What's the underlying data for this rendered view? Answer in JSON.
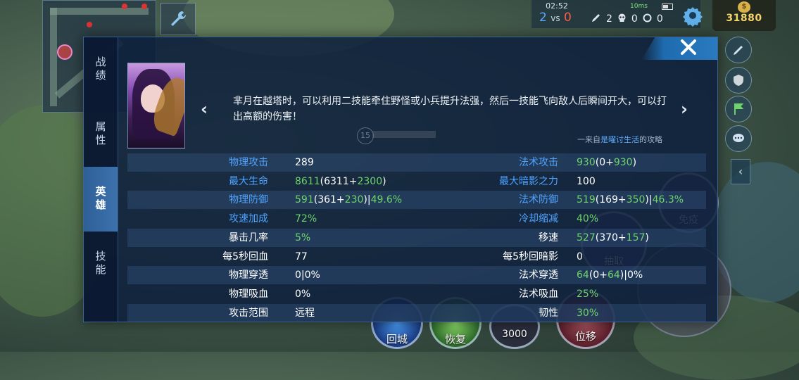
{
  "hud": {
    "timer": "02:52",
    "score_blue": "2",
    "score_vs": "vs",
    "score_red": "0",
    "kills": "2",
    "deaths": "0",
    "assists": "0",
    "signal": "10ms",
    "gold": "31880"
  },
  "tabs": [
    {
      "label": "战绩",
      "icon": "tab"
    },
    {
      "label": "属性",
      "icon": "tab"
    },
    {
      "label": "英雄",
      "icon": "tab",
      "active": true
    },
    {
      "label": "技能",
      "icon": "tab"
    }
  ],
  "tip": {
    "text": "芈月在越塔时，可以利用二技能牵住野怪或小兵提升法强，然后一技能飞向敌人后瞬间开大，可以打出高额的伤害！",
    "level": "15",
    "source_prefix": "一来自",
    "source_author": "是曜讨生活",
    "source_suffix": "的攻略"
  },
  "stats": [
    {
      "l_label": "物理攻击",
      "l_color": "blue",
      "l_value": [
        {
          "t": "289"
        }
      ],
      "r_label": "法术攻击",
      "r_color": "blue",
      "r_value": [
        {
          "t": "930",
          "g": true
        },
        {
          "t": "(0+"
        },
        {
          "t": "930",
          "g": true
        },
        {
          "t": ")"
        }
      ]
    },
    {
      "l_label": "最大生命",
      "l_color": "blue",
      "l_value": [
        {
          "t": "8611",
          "g": true
        },
        {
          "t": "(6311+"
        },
        {
          "t": "2300",
          "g": true
        },
        {
          "t": ")"
        }
      ],
      "r_label": "最大暗影之力",
      "r_color": "blue",
      "r_value": [
        {
          "t": "100"
        }
      ]
    },
    {
      "l_label": "物理防御",
      "l_color": "blue",
      "l_value": [
        {
          "t": "591",
          "g": true
        },
        {
          "t": "(361+"
        },
        {
          "t": "230",
          "g": true
        },
        {
          "t": ")|"
        },
        {
          "t": "49.6%",
          "g": true
        }
      ],
      "r_label": "法术防御",
      "r_color": "blue",
      "r_value": [
        {
          "t": "519",
          "g": true
        },
        {
          "t": "(169+"
        },
        {
          "t": "350",
          "g": true
        },
        {
          "t": ")|"
        },
        {
          "t": "46.3%",
          "g": true
        }
      ]
    },
    {
      "l_label": "攻速加成",
      "l_color": "blue",
      "l_value": [
        {
          "t": "72%",
          "g": true
        }
      ],
      "r_label": "冷却缩减",
      "r_color": "blue",
      "r_value": [
        {
          "t": "40%",
          "g": true
        }
      ]
    },
    {
      "l_label": "暴击几率",
      "l_color": "white",
      "l_value": [
        {
          "t": "5%",
          "g": true
        }
      ],
      "r_label": "移速",
      "r_color": "white",
      "r_value": [
        {
          "t": "527",
          "g": true
        },
        {
          "t": "(370+"
        },
        {
          "t": "157",
          "g": true
        },
        {
          "t": ")"
        }
      ]
    },
    {
      "l_label": "每5秒回血",
      "l_color": "white",
      "l_value": [
        {
          "t": "77"
        }
      ],
      "r_label": "每5秒回暗影",
      "r_color": "white",
      "r_value": [
        {
          "t": "0"
        }
      ]
    },
    {
      "l_label": "物理穿透",
      "l_color": "white",
      "l_value": [
        {
          "t": "0|0%"
        }
      ],
      "r_label": "法术穿透",
      "r_color": "white",
      "r_value": [
        {
          "t": "64",
          "g": true
        },
        {
          "t": "(0+"
        },
        {
          "t": "64",
          "g": true
        },
        {
          "t": ")|0%"
        }
      ]
    },
    {
      "l_label": "物理吸血",
      "l_color": "white",
      "l_value": [
        {
          "t": "0%"
        }
      ],
      "r_label": "法术吸血",
      "r_color": "white",
      "r_value": [
        {
          "t": "25%",
          "g": true
        }
      ]
    },
    {
      "l_label": "攻击范围",
      "l_color": "white",
      "l_value": [
        {
          "t": "远程"
        }
      ],
      "r_label": "韧性",
      "r_color": "white",
      "r_value": [
        {
          "t": "30%",
          "g": true
        }
      ]
    }
  ],
  "skills": {
    "recall": "回城",
    "heal": "恢复",
    "gold_cost": "3000",
    "flash": "位移",
    "immune": "免疫",
    "absorb": "抽取"
  },
  "colors": {
    "stat_blue": "#4ea3ff",
    "stat_green": "#6ed46a",
    "active_tab": "#3c72ad",
    "gold": "#f3d36a"
  }
}
